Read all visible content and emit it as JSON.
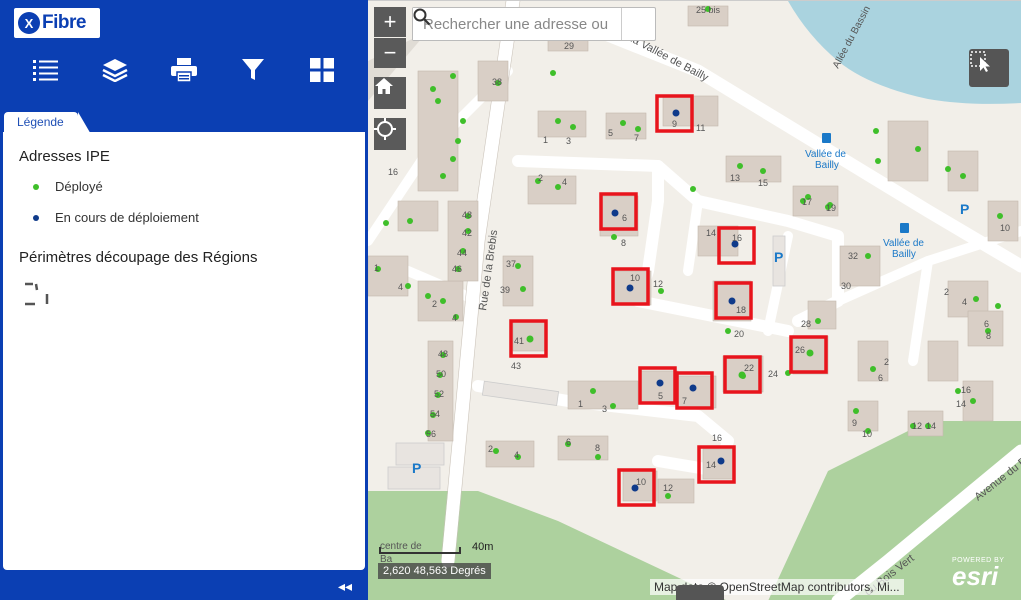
{
  "app": {
    "logo_text": "Fibre",
    "logo_mark": "X"
  },
  "toolbar": [
    {
      "name": "legend-list",
      "icon": "list-icon"
    },
    {
      "name": "layers",
      "icon": "layers-icon"
    },
    {
      "name": "print",
      "icon": "printer-icon"
    },
    {
      "name": "filter",
      "icon": "filter-icon"
    },
    {
      "name": "basemap-gallery",
      "icon": "grid-icon"
    }
  ],
  "tab": {
    "label": "Légende"
  },
  "legend": {
    "layer1_title": "Adresses IPE",
    "items": [
      {
        "label": "Déployé",
        "color": "#3fbf2a"
      },
      {
        "label": "En cours de déploiement",
        "color": "#0f3a8a"
      }
    ],
    "layer2_title": "Périmètres découpage des Régions"
  },
  "collapse_label": "◂◂",
  "map": {
    "search_placeholder": "Rechercher une adresse ou",
    "zoom_in": "+",
    "zoom_out": "−",
    "scale_label": "40m",
    "coords": "2,620 48,563 Degrés",
    "attribution": "Map data © OpenStreetMap contributors, Mi...",
    "esri_powered": "POWERED BY",
    "esri_brand": "esri",
    "streets": [
      "Rue de la Brebis",
      "Allée de la Vallée de Bailly",
      "Allée du Bassin",
      "Avenue du Bois Vert",
      "Allée du Bois Vert"
    ],
    "stops": [
      "Vallée de Bailly",
      "Vallée de Bailly"
    ],
    "other_labels": [
      "centre de",
      "Ba"
    ],
    "parking_label": "P",
    "house_numbers": [
      "25 bis",
      "29",
      "38",
      "9",
      "11",
      "1",
      "3",
      "5",
      "7",
      "16",
      "2",
      "4",
      "6",
      "8",
      "13",
      "15",
      "17",
      "19",
      "32",
      "30",
      "14",
      "16",
      "10",
      "12",
      "18",
      "20",
      "28",
      "26",
      "37",
      "39",
      "41",
      "43",
      "22",
      "24",
      "5",
      "7",
      "1",
      "3",
      "2",
      "4",
      "6",
      "8",
      "16",
      "14",
      "10",
      "12",
      "2",
      "4",
      "6",
      "8",
      "2",
      "6",
      "9",
      "10",
      "12",
      "14",
      "16"
    ],
    "green_colors": {
      "deployed": "#3fbf2a",
      "in_progress": "#0f3a8a",
      "highlight": "#e8141c"
    }
  }
}
